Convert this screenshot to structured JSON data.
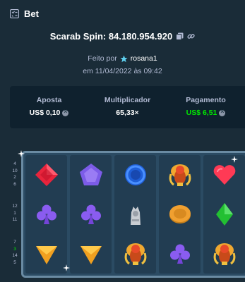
{
  "header": {
    "title": "Bet"
  },
  "spin": {
    "label": "Scarab Spin: 84.180.954.920"
  },
  "by": {
    "prefix": "Feito por",
    "user": "rosana1"
  },
  "date": "em 11/04/2022 às 09:42",
  "stats": {
    "aposta_label": "Aposta",
    "aposta_value": "US$ 0,10",
    "mult_label": "Multiplicador",
    "mult_value": "65,33×",
    "pag_label": "Pagamento",
    "pag_value": "US$ 6,51"
  },
  "paylines": {
    "top": [
      "4",
      "10",
      "2",
      "6"
    ],
    "mid": [
      "12",
      "1",
      "11"
    ],
    "low": [
      "7",
      "3",
      "14",
      "5"
    ]
  },
  "reels": [
    [
      "red-gem",
      "purple-club",
      "gold-triangle"
    ],
    [
      "purple-pentagon",
      "purple-club",
      "gold-triangle"
    ],
    [
      "blue-ring",
      "ankh-cat",
      "scarab"
    ],
    [
      "scarab",
      "gold-coin",
      "purple-club"
    ],
    [
      "red-heart",
      "green-diamond",
      "scarab"
    ]
  ],
  "colors": {
    "bg": "#1a2c38",
    "panel": "#0f212e",
    "green": "#00e701",
    "board": "#2b4b63"
  }
}
